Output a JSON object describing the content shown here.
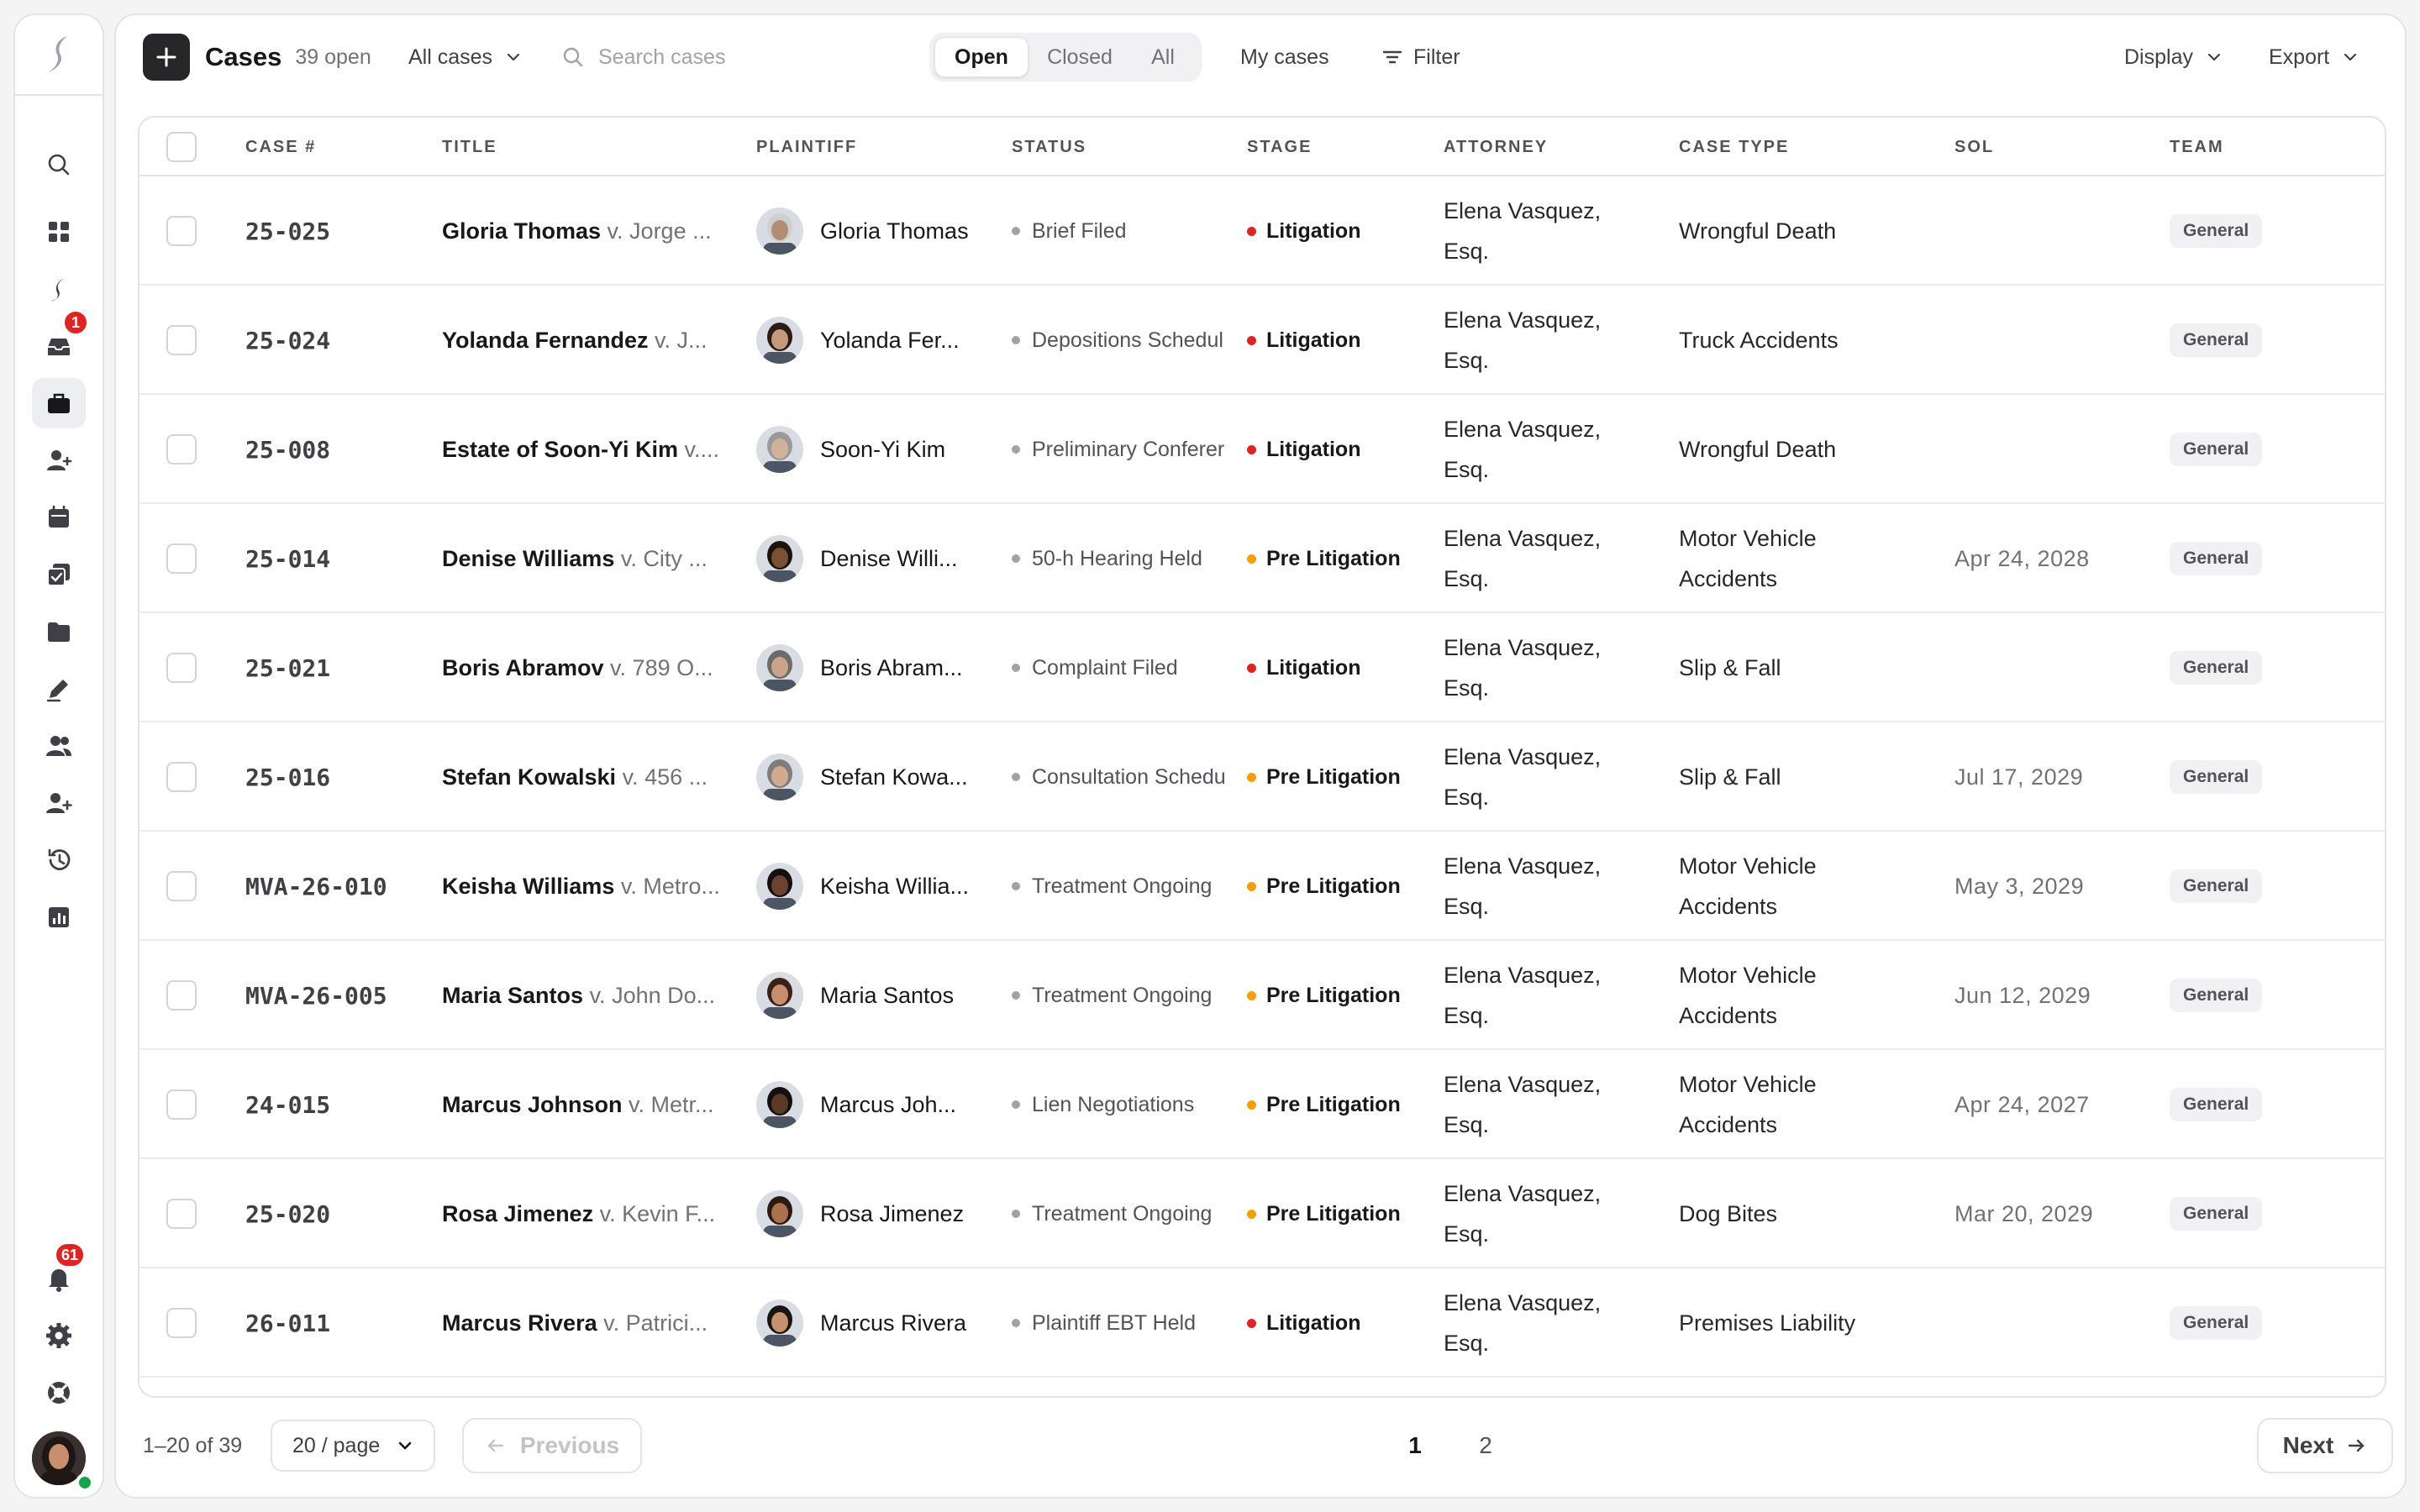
{
  "sidebar": {
    "items": [
      {
        "icon": "search-icon"
      },
      {
        "icon": "dashboard-grid-icon"
      },
      {
        "icon": "brand-s-icon"
      },
      {
        "icon": "inbox-icon",
        "badge": "1"
      },
      {
        "icon": "briefcase-icon",
        "active": true
      },
      {
        "icon": "add-contact-icon"
      },
      {
        "icon": "calendar-icon"
      },
      {
        "icon": "tasks-icon"
      },
      {
        "icon": "folder-icon"
      },
      {
        "icon": "pen-icon"
      },
      {
        "icon": "people-icon"
      },
      {
        "icon": "add-user-icon"
      },
      {
        "icon": "history-icon"
      },
      {
        "icon": "reports-icon"
      }
    ],
    "notifications_badge": "61"
  },
  "toolbar": {
    "title": "Cases",
    "count": "39 open",
    "filter_select": "All cases",
    "search_placeholder": "Search cases",
    "segments": [
      "Open",
      "Closed",
      "All"
    ],
    "active_segment": "Open",
    "my_cases": "My cases",
    "filter": "Filter",
    "display": "Display",
    "export": "Export"
  },
  "table": {
    "columns": [
      "CASE #",
      "TITLE",
      "PLAINTIFF",
      "STATUS",
      "STAGE",
      "ATTORNEY",
      "CASE TYPE",
      "SOL",
      "TEAM"
    ],
    "rows": [
      {
        "case_no": "25-025",
        "title_main": "Gloria Thomas",
        "title_sub": " v. Jorge ...",
        "plaintiff": "Gloria Thomas",
        "status": "Brief Filed",
        "stage": "Litigation",
        "stage_color": "#dc2626",
        "attorney": "Elena Vasquez, Esq.",
        "case_type": "Wrongful Death",
        "sol": "",
        "team": "General",
        "skin": "#b08d74",
        "hair": "#cfcfcf"
      },
      {
        "case_no": "25-024",
        "title_main": "Yolanda Fernandez",
        "title_sub": " v. J...",
        "plaintiff": "Yolanda Fer...",
        "status": "Depositions Schedul",
        "stage": "Litigation",
        "stage_color": "#dc2626",
        "attorney": "Elena Vasquez, Esq.",
        "case_type": "Truck Accidents",
        "sol": "",
        "team": "General",
        "skin": "#c59a7c",
        "hair": "#2b1d16"
      },
      {
        "case_no": "25-008",
        "title_main": "Estate of Soon-Yi Kim",
        "title_sub": " v....",
        "plaintiff": "Soon-Yi Kim",
        "status": "Preliminary Conferer",
        "stage": "Litigation",
        "stage_color": "#dc2626",
        "attorney": "Elena Vasquez, Esq.",
        "case_type": "Wrongful Death",
        "sol": "",
        "team": "General",
        "skin": "#d2b19a",
        "hair": "#9a9a9a"
      },
      {
        "case_no": "25-014",
        "title_main": "Denise Williams",
        "title_sub": " v. City ...",
        "plaintiff": "Denise Willi...",
        "status": "50-h Hearing Held",
        "stage": "Pre Litigation",
        "stage_color": "#f59e0b",
        "attorney": "Elena Vasquez, Esq.",
        "case_type": "Motor Vehicle Accidents",
        "sol": "Apr 24, 2028",
        "team": "General",
        "skin": "#7a5035",
        "hair": "#1c130e"
      },
      {
        "case_no": "25-021",
        "title_main": "Boris Abramov",
        "title_sub": " v. 789 O...",
        "plaintiff": "Boris Abram...",
        "status": "Complaint Filed",
        "stage": "Litigation",
        "stage_color": "#dc2626",
        "attorney": "Elena Vasquez, Esq.",
        "case_type": "Slip & Fall",
        "sol": "",
        "team": "General",
        "skin": "#c9a48a",
        "hair": "#6b6b6b"
      },
      {
        "case_no": "25-016",
        "title_main": "Stefan Kowalski",
        "title_sub": " v. 456 ...",
        "plaintiff": "Stefan Kowa...",
        "status": "Consultation Schedu",
        "stage": "Pre Litigation",
        "stage_color": "#f59e0b",
        "attorney": "Elena Vasquez, Esq.",
        "case_type": "Slip & Fall",
        "sol": "Jul 17, 2029",
        "team": "General",
        "skin": "#d1ab90",
        "hair": "#7d7d7d"
      },
      {
        "case_no": "MVA-26-010",
        "title_main": "Keisha Williams",
        "title_sub": " v. Metro...",
        "plaintiff": "Keisha Willia...",
        "status": "Treatment Ongoing",
        "stage": "Pre Litigation",
        "stage_color": "#f59e0b",
        "attorney": "Elena Vasquez, Esq.",
        "case_type": "Motor Vehicle Accidents",
        "sol": "May 3, 2029",
        "team": "General",
        "skin": "#6b4330",
        "hair": "#151010"
      },
      {
        "case_no": "MVA-26-005",
        "title_main": "Maria Santos",
        "title_sub": " v. John Do...",
        "plaintiff": "Maria Santos",
        "status": "Treatment Ongoing",
        "stage": "Pre Litigation",
        "stage_color": "#f59e0b",
        "attorney": "Elena Vasquez, Esq.",
        "case_type": "Motor Vehicle Accidents",
        "sol": "Jun 12, 2029",
        "team": "General",
        "skin": "#c98e6e",
        "hair": "#3a2218"
      },
      {
        "case_no": "24-015",
        "title_main": "Marcus Johnson",
        "title_sub": " v. Metr...",
        "plaintiff": "Marcus Joh...",
        "status": "Lien Negotiations",
        "stage": "Pre Litigation",
        "stage_color": "#f59e0b",
        "attorney": "Elena Vasquez, Esq.",
        "case_type": "Motor Vehicle Accidents",
        "sol": "Apr 24, 2027",
        "team": "General",
        "skin": "#5c3a28",
        "hair": "#141010"
      },
      {
        "case_no": "25-020",
        "title_main": "Rosa Jimenez",
        "title_sub": " v. Kevin F...",
        "plaintiff": "Rosa Jimenez",
        "status": "Treatment Ongoing",
        "stage": "Pre Litigation",
        "stage_color": "#f59e0b",
        "attorney": "Elena Vasquez, Esq.",
        "case_type": "Dog Bites",
        "sol": "Mar 20, 2029",
        "team": "General",
        "skin": "#a9714e",
        "hair": "#2a1a12"
      },
      {
        "case_no": "26-011",
        "title_main": "Marcus Rivera",
        "title_sub": " v. Patrici...",
        "plaintiff": "Marcus Rivera",
        "status": "Plaintiff EBT Held",
        "stage": "Litigation",
        "stage_color": "#dc2626",
        "attorney": "Elena Vasquez, Esq.",
        "case_type": "Premises Liability",
        "sol": "",
        "team": "General",
        "skin": "#c4926f",
        "hair": "#1a1411"
      }
    ]
  },
  "footer": {
    "range": "1–20 of 39",
    "page_size": "20 / page",
    "previous": "Previous",
    "pages": [
      "1",
      "2"
    ],
    "current_page": "1",
    "next": "Next"
  }
}
